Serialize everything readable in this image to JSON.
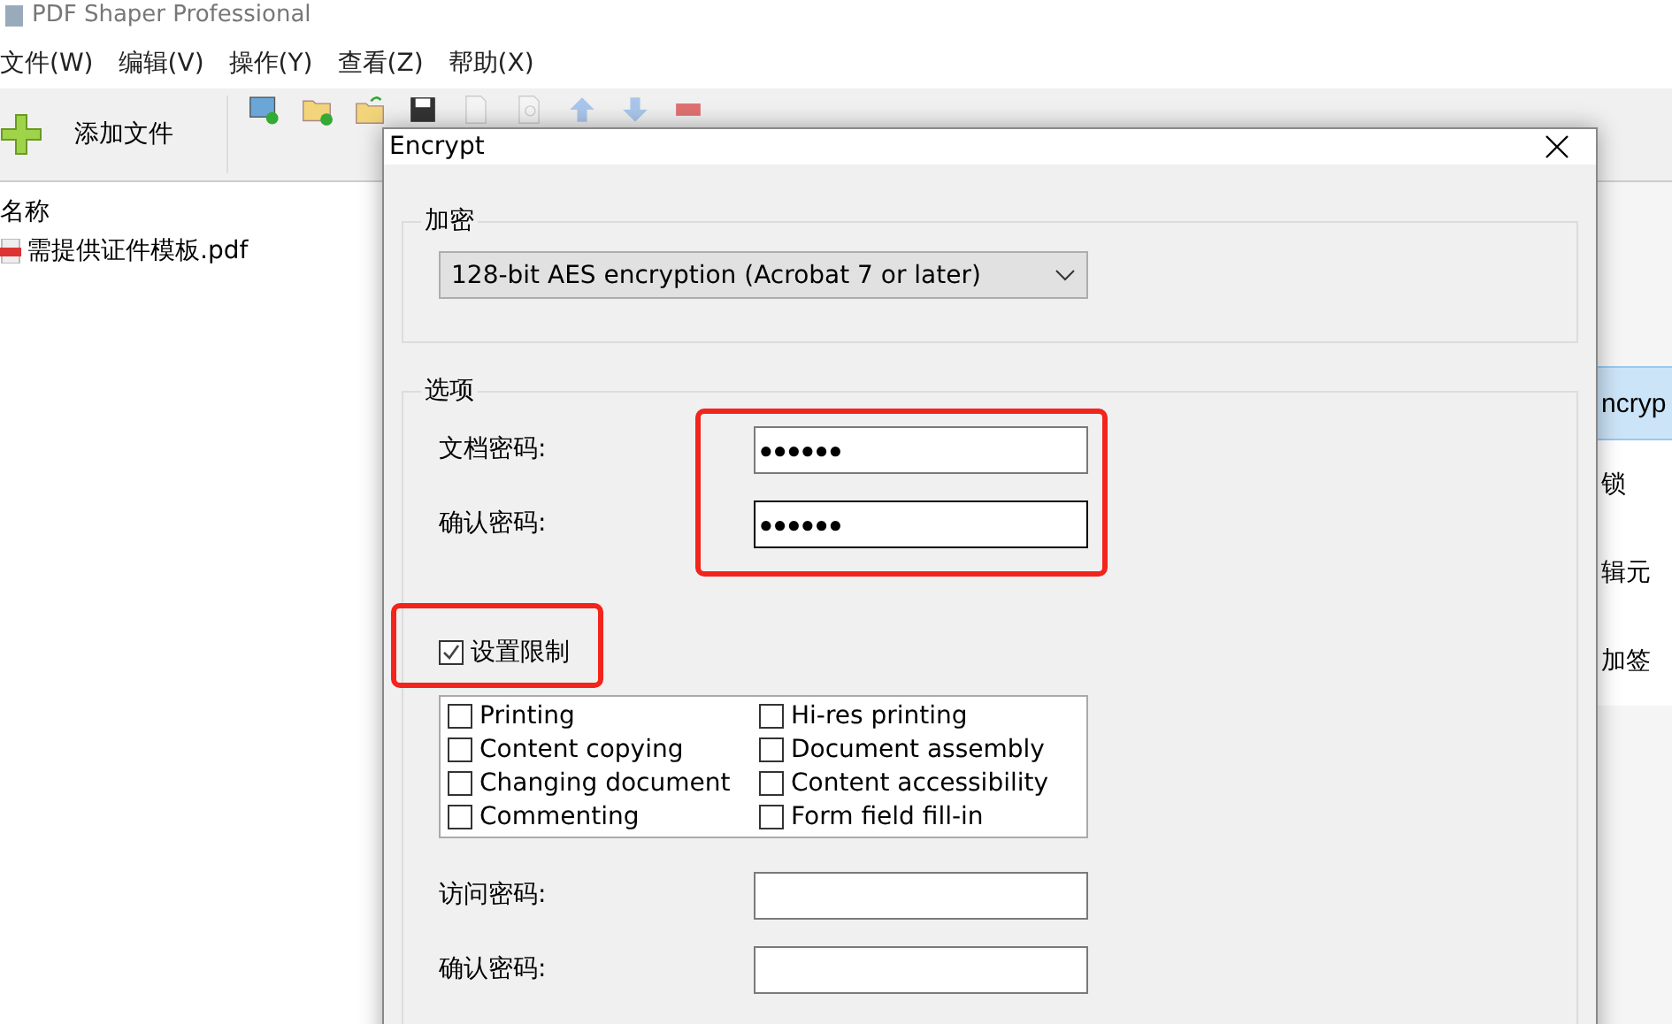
{
  "app": {
    "title": "PDF Shaper Professional",
    "menu": [
      "文件(W)",
      "编辑(V)",
      "操作(Y)",
      "查看(Z)",
      "帮助(X)"
    ],
    "toolbar": {
      "add_label": "添加文件"
    },
    "file_list": {
      "header": "名称",
      "files": [
        "需提供证件模板.pdf"
      ]
    },
    "side_panel": [
      {
        "label": "ncryp",
        "selected": true
      },
      {
        "label": "锁",
        "selected": false
      },
      {
        "label": "辑元",
        "selected": false
      },
      {
        "label": "加签",
        "selected": false
      }
    ]
  },
  "dialog": {
    "title": "Encrypt",
    "encryption_group": {
      "title": "加密",
      "method": "128-bit AES encryption (Acrobat 7 or later)"
    },
    "options_group": {
      "title": "选项",
      "document_password": {
        "label": "文档密码:",
        "value": "●●●●●●"
      },
      "confirm_password": {
        "label": "确认密码:",
        "value": "●●●●●●"
      },
      "set_restrictions": {
        "label": "设置限制",
        "checked": true
      },
      "permissions": [
        {
          "label": "Printing",
          "checked": false
        },
        {
          "label": "Hi-res printing",
          "checked": false
        },
        {
          "label": "Content copying",
          "checked": false
        },
        {
          "label": "Document assembly",
          "checked": false
        },
        {
          "label": "Changing document",
          "checked": false
        },
        {
          "label": "Content accessibility",
          "checked": false
        },
        {
          "label": "Commenting",
          "checked": false
        },
        {
          "label": "Form field fill-in",
          "checked": false
        }
      ],
      "access_password": {
        "label": "访问密码:"
      },
      "access_confirm": {
        "label": "确认密码:"
      }
    }
  }
}
